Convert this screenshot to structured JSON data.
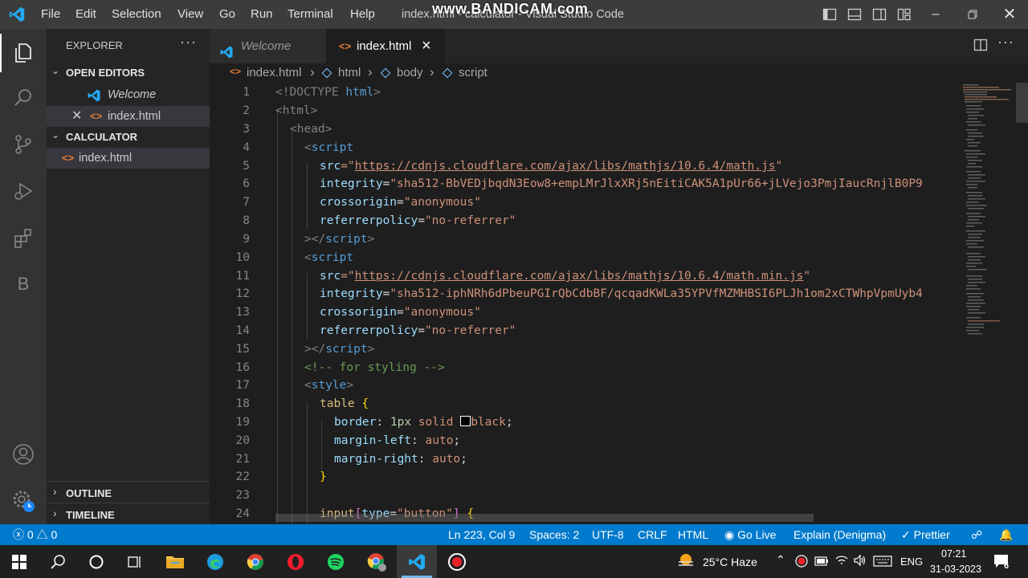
{
  "titlebar": {
    "menu": [
      "File",
      "Edit",
      "Selection",
      "View",
      "Go",
      "Run",
      "Terminal",
      "Help"
    ],
    "window_title": "index.html - calculator - Visual Studio Code",
    "watermark": "www.BANDICAM.com"
  },
  "activitybar": {
    "icons": [
      "explorer-icon",
      "search-icon",
      "source-control-icon",
      "run-debug-icon",
      "extensions-icon",
      "b-extension-icon",
      "account-icon",
      "settings-gear-icon"
    ],
    "b_label": "B"
  },
  "sidebar": {
    "title": "EXPLORER",
    "open_editors_label": "OPEN EDITORS",
    "open_editors": [
      {
        "name": "Welcome",
        "icon": "vscode-icon"
      },
      {
        "name": "index.html",
        "icon": "html-icon"
      }
    ],
    "folder_label": "CALCULATOR",
    "files": [
      {
        "name": "index.html",
        "icon": "html-icon"
      }
    ],
    "outline_label": "OUTLINE",
    "timeline_label": "TIMELINE"
  },
  "tabs": [
    {
      "label": "Welcome",
      "active": false
    },
    {
      "label": "index.html",
      "active": true,
      "close": "×"
    }
  ],
  "breadcrumb": [
    "index.html",
    "html",
    "body",
    "script"
  ],
  "editor": {
    "line_numbers": [
      "1",
      "2",
      "3",
      "4",
      "5",
      "6",
      "7",
      "8",
      "9",
      "10",
      "11",
      "12",
      "13",
      "14",
      "15",
      "16",
      "17",
      "18",
      "19",
      "20",
      "21",
      "22",
      "23",
      "24"
    ],
    "lines": {
      "l1_a": "<!DOCTYPE",
      "l1_b": "html",
      "l1_c": ">",
      "l2": "<html>",
      "l3": "<head>",
      "l4_a": "<",
      "l4_b": "script",
      "l5_a": "src",
      "l5_b": "=\"",
      "l5_c": "https://cdnjs.cloudflare.com/ajax/libs/mathjs/10.6.4/math.js",
      "l5_d": "\"",
      "l6_a": "integrity",
      "l6_b": "=",
      "l6_c": "\"sha512-BbVEDjbqdN3Eow8+empLMrJlxXRj5nEitiCAK5A1pUr66+jLVejo3PmjIaucRnjlB0P9",
      "l7_a": "crossorigin",
      "l7_b": "=",
      "l7_c": "\"anonymous\"",
      "l8_a": "referrerpolicy",
      "l8_b": "=",
      "l8_c": "\"no-referrer\"",
      "l9_a": "></",
      "l9_b": "script",
      "l9_c": ">",
      "l10_a": "<",
      "l10_b": "script",
      "l11_a": "src",
      "l11_b": "=\"",
      "l11_c": "https://cdnjs.cloudflare.com/ajax/libs/mathjs/10.6.4/math.min.js",
      "l11_d": "\"",
      "l12_a": "integrity",
      "l12_b": "=",
      "l12_c": "\"sha512-iphNRh6dPbeuPGIrQbCdbBF/qcqadKWLa35YPVfMZMHBSI6PLJh1om2xCTWhpVpmUyb4",
      "l13_a": "crossorigin",
      "l13_b": "=",
      "l13_c": "\"anonymous\"",
      "l14_a": "referrerpolicy",
      "l14_b": "=",
      "l14_c": "\"no-referrer\"",
      "l15_a": "></",
      "l15_b": "script",
      "l15_c": ">",
      "l16": "<!-- for styling -->",
      "l17_a": "<",
      "l17_b": "style",
      "l17_c": ">",
      "l18_a": "table",
      "l18_b": "{",
      "l19_a": "border",
      "l19_b": ":",
      "l19_c": "1px",
      "l19_d": "solid",
      "l19_e": "black",
      "l19_f": ";",
      "l20_a": "margin-left",
      "l20_b": ":",
      "l20_c": "auto",
      "l20_d": ";",
      "l21_a": "margin-right",
      "l21_b": ":",
      "l21_c": "auto",
      "l21_d": ";",
      "l22": "}",
      "l24_a": "input",
      "l24_b": "[",
      "l24_c": "type",
      "l24_d": "=",
      "l24_e": "\"button\"",
      "l24_f": "]",
      "l24_g": "{"
    }
  },
  "statusbar": {
    "errors": "0",
    "warnings": "0",
    "position": "Ln 223, Col 9",
    "spaces": "Spaces: 2",
    "encoding": "UTF-8",
    "eol": "CRLF",
    "language": "HTML",
    "golive": "Go Live",
    "explain": "Explain (Denigma)",
    "prettier": "Prettier"
  },
  "taskbar": {
    "apps": [
      "windows-start-icon",
      "search-icon",
      "cortana-icon",
      "task-view-icon",
      "file-explorer-icon",
      "edge-icon",
      "chrome-icon",
      "opera-icon",
      "spotify-icon",
      "chrome-profile-icon",
      "vscode-icon",
      "bandicam-record-icon"
    ],
    "weather": "25°C  Haze",
    "language": "ENG",
    "time": "07:21",
    "date": "31-03-2023",
    "notifications": "6"
  },
  "colors": {
    "statusbar": "#007acc",
    "activitybar": "#333333",
    "sidebar": "#252526",
    "editor": "#1e1e1e",
    "titlebar": "#3c3c3c"
  }
}
